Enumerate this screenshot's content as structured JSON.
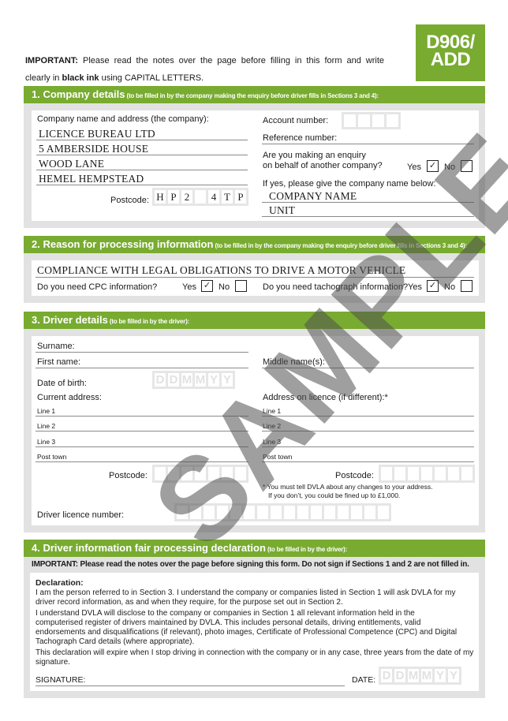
{
  "badge": {
    "line1": "D906/",
    "line2": "ADD"
  },
  "intro": {
    "important_label": "IMPORTANT:",
    "line1_rest": " Please read the notes over the page before filling in this form and write",
    "line2_pre": "clearly in ",
    "line2_bold": "black ink",
    "line2_post": " using CAPITAL LETTERS."
  },
  "section1": {
    "title": "1.  Company details",
    "subtitle": " (to be filled in by the company making the enquiry before driver fills in Sections 3 and 4):",
    "company_label": "Company name and address (the company):",
    "address_lines": [
      "LICENCE BUREAU LTD",
      "5 AMBERSIDE HOUSE",
      "WOOD LANE",
      "HEMEL HEMPSTEAD"
    ],
    "postcode_label": "Postcode:",
    "postcode_chars": [
      "H",
      "P",
      "2",
      "",
      "4",
      "T",
      "P"
    ],
    "account_label": "Account number:",
    "account_chars": [
      "",
      "",
      "",
      ""
    ],
    "reference_label": "Reference number:",
    "enquiry_q_line1": "Are you making an enquiry",
    "enquiry_q_line2": "on behalf of another company?",
    "yes_label": "Yes",
    "no_label": "No",
    "enquiry_yes": "✓",
    "enquiry_no": "",
    "other_company_label": "If yes, please give the company name below:",
    "other_company_lines": [
      "COMPANY NAME",
      "UNIT"
    ]
  },
  "section2": {
    "title": "2.  Reason for processing information",
    "subtitle": " (to be filled in by the company making the enquiry before driver fills in Sections 3 and 4):",
    "reason": "COMPLIANCE WITH LEGAL OBLIGATIONS TO DRIVE A MOTOR VEHICLE",
    "cpc_q": "Do you need CPC information?",
    "tacho_q": "Do you need tachograph information?",
    "yes_label": "Yes",
    "no_label": "No",
    "cpc_yes": "✓",
    "cpc_no": "",
    "tacho_yes": "✓",
    "tacho_no": ""
  },
  "section3": {
    "title": "3.  Driver details",
    "subtitle": " (to be filled in by the driver):",
    "surname_label": "Surname:",
    "first_name_label": "First name:",
    "middle_name_label": "Middle name(s):",
    "dob_label": "Date of birth:",
    "dob_placeholder": [
      "D",
      "D",
      "M",
      "M",
      "Y",
      "Y"
    ],
    "current_address_label": "Current address:",
    "licence_address_label": "Address on licence (if different):*",
    "address_line_labels": [
      "Line 1",
      "Line 2",
      "Line 3",
      "Post town"
    ],
    "postcode_label": "Postcode:",
    "postcode_chars": [
      "",
      "",
      "",
      "",
      "",
      "",
      ""
    ],
    "note_line1": "* You must tell DVLA about any changes to your address.",
    "note_line2": "If you don’t, you could be fined up to £1,000.",
    "licence_number_label": "Driver licence number:",
    "licence_chars": [
      "",
      "",
      "",
      "",
      "",
      "",
      "",
      "",
      "",
      "",
      "",
      "",
      "",
      "",
      "",
      ""
    ]
  },
  "section4": {
    "title": "4.  Driver information fair processing declaration",
    "subtitle": " (to be filled in by the driver):",
    "important": "IMPORTANT: Please read the notes over the page before signing this form. Do not sign if Sections 1 and 2 are not filled in.",
    "declaration_heading": "Declaration:",
    "para1": "I am the person referred to in Section 3. I understand the company or companies listed in Section 1 will ask DVLA for my driver record information, as and when they require, for the purpose set out in Section 2.",
    "para2": "I understand DVLA will disclose to the company or companies in Section 1 all relevant information held in the computerised register of drivers maintained by DVLA. This includes personal details, driving entitlements, valid endorsements and disqualifications (if relevant), photo images, Certificate of Professional Competence (CPC) and Digital Tachograph Card details (where appropriate).",
    "para3": "This declaration will expire when I stop driving in connection with the company or in any case, three years from the date of my signature.",
    "signature_label": "SIGNATURE:",
    "date_label": "DATE:",
    "date_placeholder": [
      "D",
      "D",
      "M",
      "M",
      "Y",
      "Y"
    ]
  },
  "watermark": "SAMPLE",
  "colors": {
    "brand_green": "#78ab30",
    "panel_gray": "#e2e2e2"
  }
}
